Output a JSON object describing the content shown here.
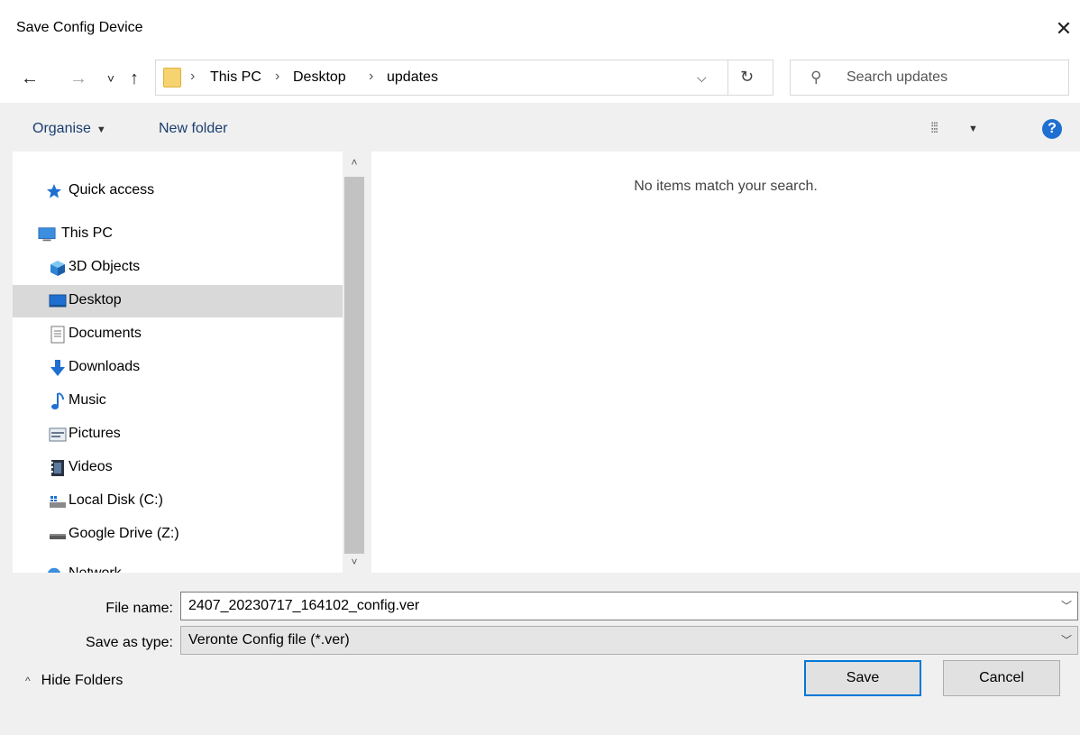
{
  "window": {
    "title": "Save Config Device",
    "close": "✕"
  },
  "nav": {
    "back": "←",
    "forward": "→",
    "recent": "˅",
    "up": "↑"
  },
  "address": {
    "segments": [
      "This PC",
      "Desktop",
      "updates"
    ],
    "separator": "›",
    "dropdown": "⌵",
    "refresh": "↻"
  },
  "search": {
    "placeholder": "Search updates",
    "value": ""
  },
  "toolbar": {
    "organise": "Organise",
    "organise_caret": "▼",
    "new_folder": "New folder",
    "views_caret": "▼",
    "help": "?"
  },
  "sidebar": {
    "items": [
      {
        "label": "Quick access",
        "icon": "star-icon"
      },
      {
        "label": "This PC",
        "icon": "computer-icon"
      },
      {
        "label": "3D Objects",
        "icon": "cube-icon"
      },
      {
        "label": "Desktop",
        "icon": "desktop-icon",
        "selected": true
      },
      {
        "label": "Documents",
        "icon": "document-icon"
      },
      {
        "label": "Downloads",
        "icon": "download-icon"
      },
      {
        "label": "Music",
        "icon": "music-icon"
      },
      {
        "label": "Pictures",
        "icon": "picture-icon"
      },
      {
        "label": "Videos",
        "icon": "video-icon"
      },
      {
        "label": "Local Disk (C:)",
        "icon": "disk-icon"
      },
      {
        "label": "Google Drive (Z:)",
        "icon": "drive-icon"
      },
      {
        "label": "Network",
        "icon": "network-icon"
      }
    ],
    "scroll_up": "˄",
    "scroll_down": "˅"
  },
  "content": {
    "empty_message": "No items match your search."
  },
  "form": {
    "file_name_label": "File name:",
    "file_name_value": "2407_20230717_164102_config.ver",
    "save_type_label": "Save as type:",
    "save_type_value": "Veronte Config file (*.ver)",
    "dropdown_arrow": "﹀"
  },
  "footer": {
    "hide_folders": "Hide Folders",
    "hide_caret": "^",
    "save": "Save",
    "cancel": "Cancel"
  },
  "colors": {
    "accent": "#0078d7",
    "selected_bg": "#d9d9d9",
    "help_blue": "#1f6fd1"
  }
}
